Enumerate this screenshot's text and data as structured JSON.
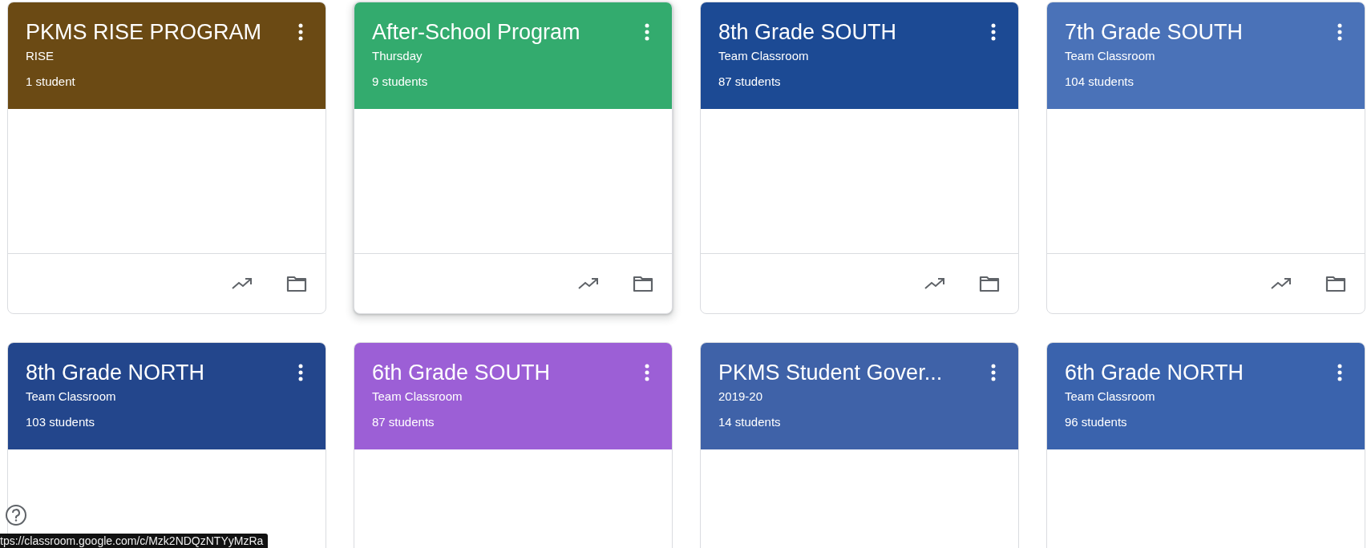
{
  "classes": [
    {
      "title": "PKMS RISE PROGRAM",
      "section": "RISE",
      "students": "1 student",
      "color": "#6b4a14",
      "hovered": false
    },
    {
      "title": "After-School Program",
      "section": "Thursday",
      "students": "9 students",
      "color": "#33ab6e",
      "hovered": true
    },
    {
      "title": "8th Grade SOUTH",
      "section": "Team Classroom",
      "students": "87 students",
      "color": "#1c4a94",
      "hovered": false
    },
    {
      "title": "7th Grade SOUTH",
      "section": "Team Classroom",
      "students": "104 students",
      "color": "#4a72b8",
      "hovered": false
    },
    {
      "title": "8th Grade NORTH",
      "section": "Team Classroom",
      "students": "103 students",
      "color": "#23468c",
      "hovered": false
    },
    {
      "title": "6th Grade SOUTH",
      "section": "Team Classroom",
      "students": "87 students",
      "color": "#9c5fd6",
      "hovered": false
    },
    {
      "title": "PKMS Student Gover...",
      "section": "2019-20",
      "students": "14 students",
      "color": "#3f62a8",
      "hovered": false
    },
    {
      "title": "6th Grade NORTH",
      "section": "Team Classroom",
      "students": "96 students",
      "color": "#3a63ad",
      "hovered": false
    }
  ],
  "status_bar": {
    "url": "tps://classroom.google.com/c/Mzk2NDQzNTYyMzRa"
  }
}
